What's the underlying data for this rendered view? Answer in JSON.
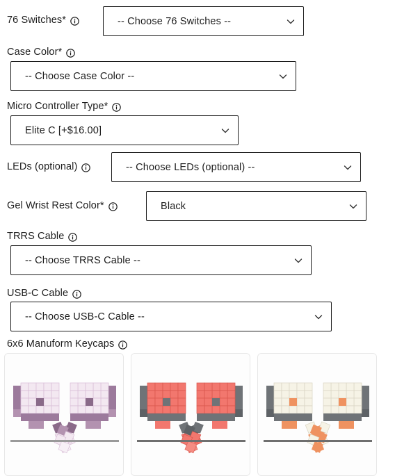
{
  "form": {
    "rows": [
      {
        "id": "switches",
        "label": "76 Switches*",
        "value": "-- Choose 76 Switches --",
        "icon": "info-icon",
        "layout": "inline"
      },
      {
        "id": "case-color",
        "label": "Case Color*",
        "value": "-- Choose Case Color --",
        "icon": "info-icon",
        "layout": "stacked"
      },
      {
        "id": "micro-controller-type",
        "label": "Micro Controller Type*",
        "value": "Elite C [+$16.00]",
        "icon": "info-icon",
        "layout": "stacked"
      },
      {
        "id": "leds",
        "label": "LEDs (optional)",
        "value": "-- Choose LEDs (optional) --",
        "icon": "info-icon",
        "layout": "inline"
      },
      {
        "id": "gel-wrist-rest-color",
        "label": "Gel Wrist Rest Color*",
        "value": "Black",
        "icon": "info-icon",
        "layout": "inline"
      },
      {
        "id": "trrs-cable",
        "label": "TRRS Cable",
        "value": "-- Choose TRRS Cable --",
        "icon": "info-icon",
        "layout": "stacked"
      },
      {
        "id": "usb-c-cable",
        "label": "USB-C Cable",
        "value": "-- Choose USB-C Cable --",
        "icon": "info-icon",
        "layout": "stacked"
      }
    ],
    "keycaps": {
      "label": "6x6 Manuform Keycaps",
      "icon": "info-icon",
      "options": [
        {
          "id": "keycaps-purple",
          "accent": "#9c7a9c",
          "light": "#f3e8f1",
          "mid": "#b392b0",
          "dark": "#8a6a89"
        },
        {
          "id": "keycaps-red",
          "accent": "#f2776e",
          "light": "#f58c82",
          "mid": "#6f7377",
          "dark": "#5e6266"
        },
        {
          "id": "keycaps-cream",
          "accent": "#ef9260",
          "light": "#f6f3e6",
          "mid": "#6f7377",
          "dark": "#5e6266"
        }
      ]
    }
  },
  "colors": {
    "text": "#1d1d1d",
    "border": "#1c1c1c",
    "card_border": "#e7e7e7",
    "background": "#ffffff",
    "desk_line": "#8c8c8c"
  }
}
